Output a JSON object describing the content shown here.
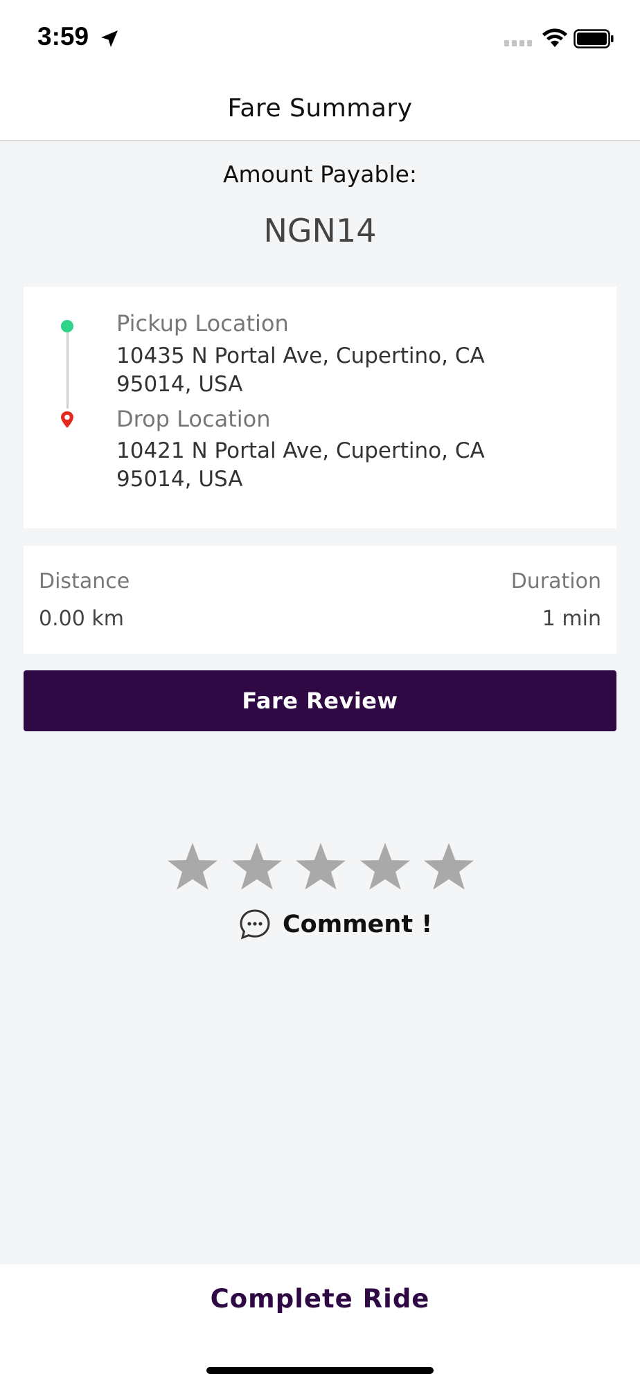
{
  "status_bar": {
    "time": "3:59",
    "icons": [
      "location-arrow-icon",
      "cellular-signal-icon",
      "wifi-icon",
      "battery-icon"
    ]
  },
  "header": {
    "title": "Fare Summary"
  },
  "amount": {
    "label": "Amount Payable:",
    "value": "NGN14"
  },
  "locations": {
    "pickup": {
      "label": "Pickup Location",
      "address_line1": "10435 N Portal Ave, Cupertino, CA",
      "address_line2": "95014, USA"
    },
    "drop": {
      "label": "Drop Location",
      "address_line1": "10421 N Portal Ave, Cupertino, CA",
      "address_line2": "95014, USA"
    }
  },
  "trip": {
    "distance_label": "Distance",
    "distance_value": "0.00 km",
    "duration_label": "Duration",
    "duration_value": "1 min"
  },
  "fare_review": {
    "label": "Fare Review"
  },
  "rating": {
    "max": 5,
    "selected": 0
  },
  "comment": {
    "label": "Comment !"
  },
  "footer": {
    "complete_ride_label": "Complete Ride"
  },
  "colors": {
    "primary": "#2e0944",
    "pickup_dot": "#2fd48a",
    "drop_pin": "#e5281c",
    "star_inactive": "#a9a9a9",
    "background": "#f4f5f7"
  }
}
